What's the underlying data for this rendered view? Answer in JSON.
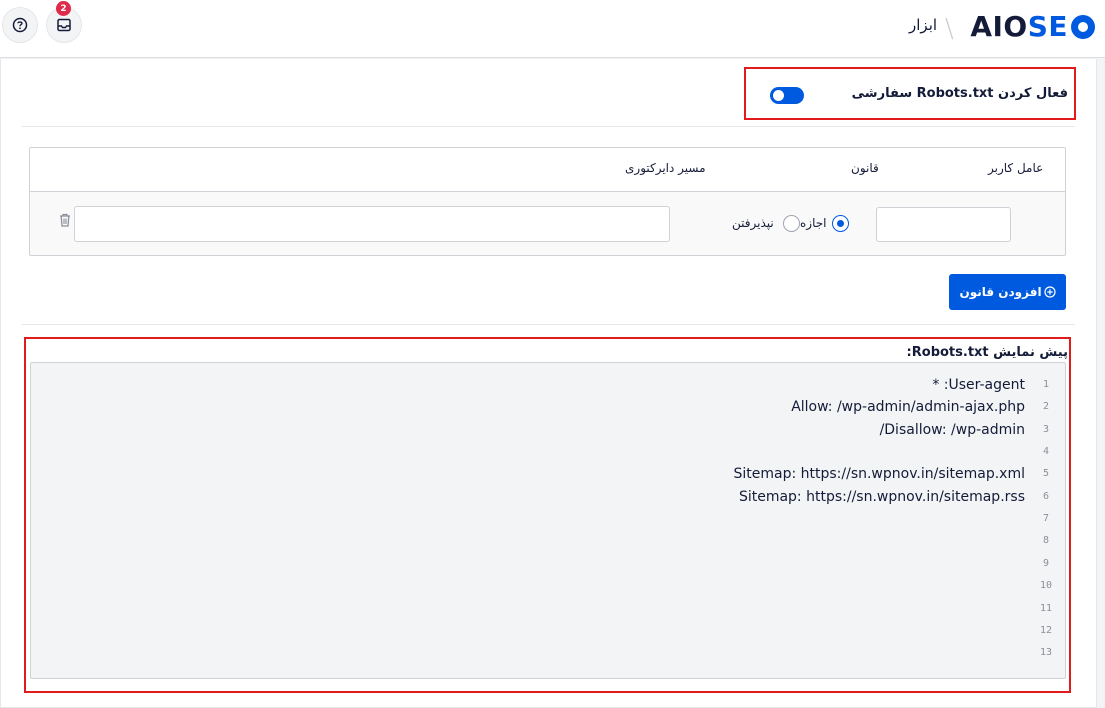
{
  "header": {
    "logo": {
      "part1": "AIO",
      "part2": "SE"
    },
    "breadcrumb": "ابزار",
    "notifications_count": "2",
    "icons": [
      "help-icon",
      "inbox-icon"
    ]
  },
  "robots": {
    "toggle_label": "فعال کردن Robots.txt سفارشی",
    "enabled": true
  },
  "rules_table": {
    "headers": [
      "عامل کاربر",
      "قانون",
      "مسیر دایرکتوری"
    ],
    "row": {
      "user_agent": "",
      "rule_allow": "اجازه",
      "rule_disallow": "نپذیرفتن",
      "selected": "allow",
      "path": ""
    }
  },
  "add_rule_label": "افزودن قانون",
  "preview": {
    "title": "پیش نمایش Robots.txt:",
    "lines": [
      {
        "num": "1",
        "text": "User-agent: *"
      },
      {
        "num": "2",
        "text": "Allow: /wp-admin/admin-ajax.php"
      },
      {
        "num": "3",
        "text": "Disallow: /wp-admin/"
      },
      {
        "num": "4",
        "text": ""
      },
      {
        "num": "5",
        "text": "Sitemap: https://sn.wpnov.in/sitemap.xml"
      },
      {
        "num": "6",
        "text": "Sitemap: https://sn.wpnov.in/sitemap.rss"
      },
      {
        "num": "7",
        "text": ""
      },
      {
        "num": "8",
        "text": ""
      },
      {
        "num": "9",
        "text": ""
      },
      {
        "num": "10",
        "text": ""
      },
      {
        "num": "11",
        "text": ""
      },
      {
        "num": "12",
        "text": ""
      },
      {
        "num": "13",
        "text": ""
      }
    ]
  },
  "colors": {
    "accent": "#005ae0",
    "highlight": "#e11b1b",
    "badge": "#df2a4a"
  }
}
